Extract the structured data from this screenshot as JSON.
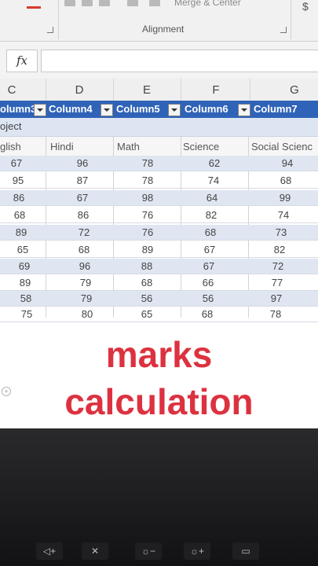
{
  "ribbon": {
    "group_label": "Alignment",
    "merge_label": "Merge & Center"
  },
  "formula_bar": {
    "fx_label": "fx",
    "value": ""
  },
  "column_letters": [
    "C",
    "D",
    "E",
    "F",
    "G"
  ],
  "table_headers": [
    "olumn3",
    "Column4",
    "Column5",
    "Column6",
    "Column7"
  ],
  "subject_label": "oject",
  "subject_headers": [
    "glish",
    "Hindi",
    "Math",
    "Science",
    "Social Scienc"
  ],
  "rows": [
    [
      "67",
      "96",
      "78",
      "62",
      "94"
    ],
    [
      "95",
      "87",
      "78",
      "74",
      "68"
    ],
    [
      "86",
      "67",
      "98",
      "64",
      "99"
    ],
    [
      "68",
      "86",
      "76",
      "82",
      "74"
    ],
    [
      "89",
      "72",
      "76",
      "68",
      "73"
    ],
    [
      "65",
      "68",
      "89",
      "67",
      "82"
    ],
    [
      "69",
      "96",
      "88",
      "67",
      "72"
    ],
    [
      "89",
      "79",
      "68",
      "66",
      "77"
    ],
    [
      "58",
      "79",
      "56",
      "56",
      "97"
    ],
    [
      "75",
      "80",
      "65",
      "68",
      "78"
    ]
  ],
  "caption": {
    "line1": "marks",
    "line2": "calculation",
    "color": "#dc3240"
  },
  "keys": [
    "◁+",
    "✕",
    "☼−",
    "☼+",
    "▭"
  ]
}
